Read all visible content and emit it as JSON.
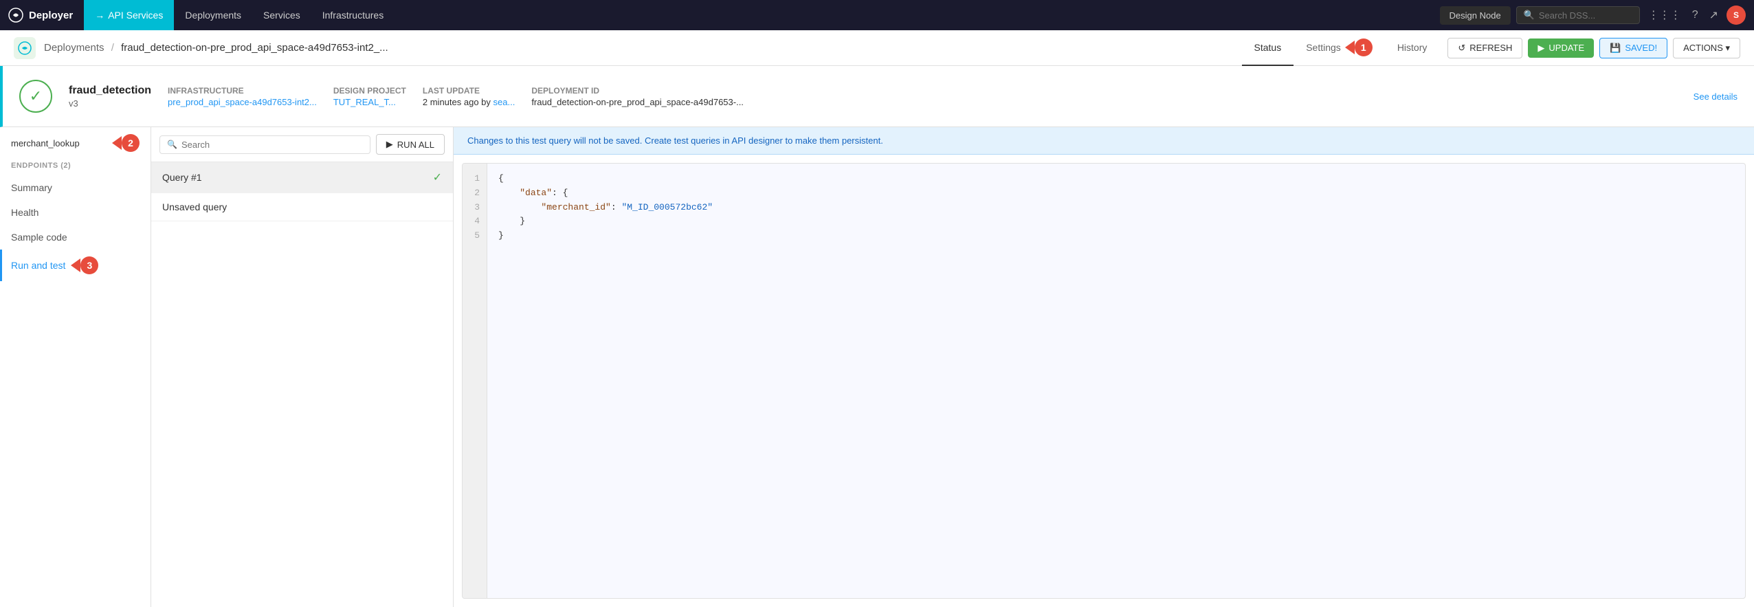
{
  "app": {
    "logo_text": "Deployer"
  },
  "topnav": {
    "items": [
      {
        "id": "api-services",
        "label": "API Services",
        "active": true,
        "arrow": "→"
      },
      {
        "id": "deployments",
        "label": "Deployments",
        "active": false
      },
      {
        "id": "services",
        "label": "Services",
        "active": false
      },
      {
        "id": "infrastructures",
        "label": "Infrastructures",
        "active": false
      }
    ],
    "design_node": "Design Node",
    "search_placeholder": "Search DSS...",
    "grid_icon": "⋮⋮⋮",
    "help_icon": "?",
    "notify_icon": "↗"
  },
  "breadcrumb": {
    "back_icon": "←",
    "path": "Deployments",
    "separator": "/",
    "current": "fraud_detection-on-pre_prod_api_space-a49d7653-int2_...",
    "tabs": [
      {
        "id": "status",
        "label": "Status",
        "active": true
      },
      {
        "id": "settings",
        "label": "Settings",
        "active": false,
        "badge": "1"
      },
      {
        "id": "history",
        "label": "History",
        "active": false
      }
    ],
    "btn_refresh": "REFRESH",
    "btn_update": "UPDATE",
    "btn_saved": "SAVED!",
    "btn_actions": "ACTIONS ▾"
  },
  "info_card": {
    "check_icon": "✓",
    "name": "fraud_detection",
    "version": "v3",
    "infra_label": "Infrastructure",
    "infra_value": "pre_prod_api_space-a49d7653-int2...",
    "project_label": "Design project",
    "project_value": "TUT_REAL_T...",
    "update_label": "Last update",
    "update_value": "2 minutes ago by sea...",
    "deploy_id_label": "Deployment ID",
    "deploy_id_value": "fraud_detection-on-pre_prod_api_space-a49d7653-...",
    "see_details": "See details"
  },
  "sidebar": {
    "service_name": "merchant_lookup",
    "badge_number": "2",
    "endpoints_label": "ENDPOINTS (2)",
    "nav_items": [
      {
        "id": "summary",
        "label": "Summary",
        "active": false
      },
      {
        "id": "health",
        "label": "Health",
        "active": false
      },
      {
        "id": "sample-code",
        "label": "Sample code",
        "active": false
      },
      {
        "id": "run-and-test",
        "label": "Run and test",
        "active": true
      }
    ]
  },
  "center_panel": {
    "search_placeholder": "Search",
    "run_all_label": "RUN ALL",
    "queries": [
      {
        "id": "query1",
        "label": "Query #1",
        "active": true,
        "check": true
      },
      {
        "id": "unsaved",
        "label": "Unsaved query",
        "active": false,
        "check": false
      }
    ]
  },
  "right_panel": {
    "banner": "Changes to this test query will not be saved. Create test queries in API designer to make them persistent.",
    "code": {
      "lines": [
        "1",
        "2",
        "3",
        "4",
        "5"
      ],
      "content": "{\n    \"data\": {\n        \"merchant_id\": \"M_ID_000572bc62\"\n    }\n}"
    }
  }
}
